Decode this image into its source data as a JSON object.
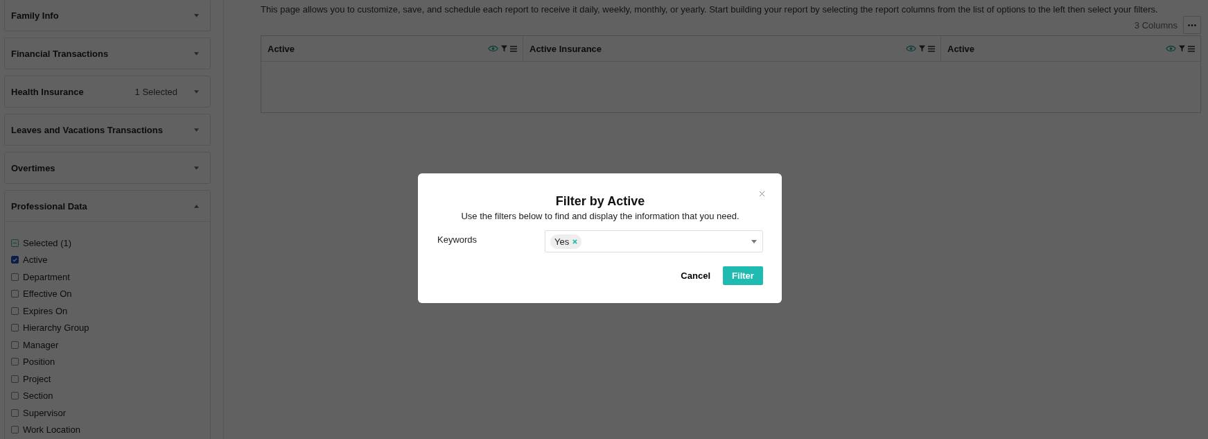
{
  "sidebar": {
    "sections": [
      {
        "title": "Family Info",
        "expanded": false
      },
      {
        "title": "Financial Transactions",
        "expanded": false
      },
      {
        "title": "Health Insurance",
        "badge": "1 Selected",
        "expanded": false
      },
      {
        "title": "Leaves and Vacations Transactions",
        "expanded": false
      },
      {
        "title": "Overtimes",
        "expanded": false
      },
      {
        "title": "Professional Data",
        "expanded": true,
        "selected_summary": "Selected (1)",
        "items": [
          {
            "label": "Active",
            "checked": true
          },
          {
            "label": "Department",
            "checked": false
          },
          {
            "label": "Effective On",
            "checked": false
          },
          {
            "label": "Expires On",
            "checked": false
          },
          {
            "label": "Hierarchy Group",
            "checked": false
          },
          {
            "label": "Manager",
            "checked": false
          },
          {
            "label": "Position",
            "checked": false
          },
          {
            "label": "Project",
            "checked": false
          },
          {
            "label": "Section",
            "checked": false
          },
          {
            "label": "Supervisor",
            "checked": false
          },
          {
            "label": "Work Location",
            "checked": false
          }
        ]
      }
    ]
  },
  "description": "This page allows you to customize, save, and schedule each report to receive it daily, weekly, monthly, or yearly. Start building your report by selecting the report columns from the list of options to the left then select your filters.",
  "column_count": "3 Columns",
  "table": {
    "columns": [
      {
        "title": "Active"
      },
      {
        "title": "Active Insurance"
      },
      {
        "title": "Active"
      }
    ]
  },
  "modal": {
    "title": "Filter by Active",
    "subtitle": "Use the filters below to find and display the information that you need.",
    "field": {
      "label": "Keywords",
      "tags": [
        "Yes"
      ]
    },
    "cancel": "Cancel",
    "submit": "Filter"
  }
}
